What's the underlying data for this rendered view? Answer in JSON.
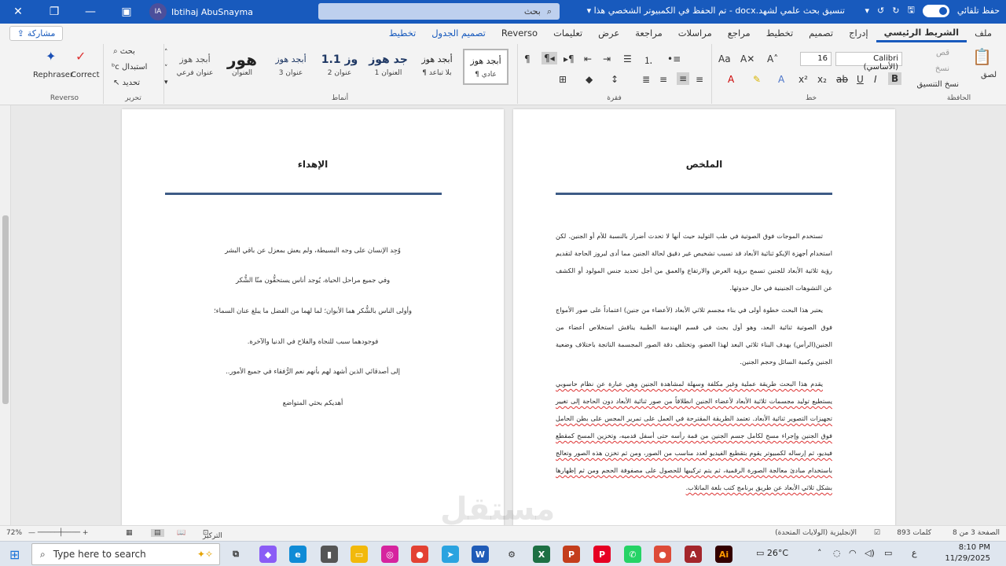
{
  "titlebar": {
    "user_initials": "IA",
    "user_name": "Ibtihaj AbuSnayma",
    "search_placeholder": "بحث",
    "doc_title": "تنسيق بحث علمي لشهد.docx - تم الحفظ في الكمبيوتر الشخصي هذا",
    "autosave_label": "حفظ تلقائي"
  },
  "tabs": [
    "ملف",
    "الشريط الرئيسي",
    "إدراج",
    "تصميم",
    "تخطيط",
    "مراجع",
    "مراسلات",
    "مراجعة",
    "عرض",
    "تعليمات",
    "Reverso",
    "تصميم الجدول",
    "تخطيط"
  ],
  "share_label": "مشاركة",
  "ribbon": {
    "clipboard": {
      "label": "الحافظة",
      "paste": "لصق",
      "cut": "قص",
      "copy": "نسخ",
      "format_painter": "نسخ التنسيق"
    },
    "font": {
      "label": "خط",
      "font_name": "Calibri (الأساسي)",
      "font_size": "16"
    },
    "paragraph": {
      "label": "فقرة"
    },
    "styles": {
      "label": "أنماط",
      "items": [
        {
          "preview": "أبجد هوز",
          "name": "¶ عادي"
        },
        {
          "preview": "أبجد هوز",
          "name": "¶ بلا تباعد"
        },
        {
          "preview": "جد هوز",
          "name": "العنوان 1"
        },
        {
          "preview": "وز 1.1",
          "name": "عنوان 2"
        },
        {
          "preview": "أبجد هوز",
          "name": "عنوان 3"
        },
        {
          "preview": "هور",
          "name": "العنوان"
        },
        {
          "preview": "أبجد هوز",
          "name": "عنوان فرعي"
        }
      ]
    },
    "editing": {
      "label": "تحرير",
      "find": "بحث",
      "replace": "استبدال",
      "select": "تحديد"
    },
    "reverso": {
      "label": "Reverso",
      "rephraser": "Rephraser",
      "correct": "Correct"
    }
  },
  "page_right": {
    "title": "الملخص",
    "paragraphs": [
      "تستخدم الموجات فوق الصوتية في طب التوليد حيث أنها لا تحدث أضرار بالنسبة للأم أو الجنين. لكن استخدام أجهزة الإيكو ثنائية الأبعاد قد تسبب تشخيص غير دقيق لحالة الجنين مما أدى لبروز الحاجة لتقديم رؤية ثلاثية الأبعاد للجنين تسمح برؤية العرض والارتفاع والعمق من أجل تحديد جنس المولود أو الكشف عن التشوهات الجنينية في حال حدوثها.",
      "يعتبر هذا البحث خطوة أولى في بناء مجسم ثلاثي الأبعاد (لأعضاء من جنين) اعتماداً على صور الأمواج فوق الصوتية ثنائية البعد، وهو أول بحث في قسم الهندسة الطبية يناقش استخلاص أعضاء من الجنين(الرأس) بهدف البناء ثلاثي البعد لهذا العضو، وتختلف دقة الصور المجسمة الناتجة باختلاف وضعية الجنين وكمية السائل وحجم الجنين.",
      "يقدم هذا البحث طريقة عملية وغير مكلفة وسهلة لمشاهدة الجنين وهي عبارة عن نظام حاسوبي يستطيع توليد مجسمات ثلاثية الأبعاد لأعضاء الجنين انطلاقاً من صور ثنائية الأبعاد دون الحاجة إلى تغيير تجهيزات التصوير ثنائية الأبعاد. تعتمد الطريقة المقترحة في العمل على تمرير المجس على بطن الحامل فوق الجنين وإجراء مسح لكامل جسم الجنين من قمة رأسه حتى أسفل قدميه، وتخزين المسح كمقطع فيديو، ثم إرساله لكمبيوتر يقوم بتقطيع الفيديو لعدد مناسب من الصور، ومن ثم تخزن هذه الصور وتعالج باستخدام مبادئ معالجة الصورة الرقمية، ثم يتم تركيبها للحصول على مصفوفة الحجم ومن ثم إظهارها بشكل ثلاثي الأبعاد عن طريق برنامج كتب بلغة الماتلاب."
    ]
  },
  "page_left": {
    "title": "الإهداء",
    "lines": [
      "وُجِد الإنسان على وجه البسيطة، ولم يعش بمعزل عن باقي البشر",
      "وفي جميع مراحل الحياة، يُوجد أناس يستحقُّون منّا الشُّكر",
      "وأولى الناس بالشُّكر هما الأبوان؛ لما لهما من الفضل ما يبلغ عنان السماء؛",
      "فوجودهما سبب للنجاة والفلاح في الدنيا والآخرة.",
      "إلى أصدقائي الذين أشهد لهم بأنهم نعم الرُّفقاء في جميع الأمور..",
      "أهديكم بحثي المتواضع"
    ]
  },
  "status": {
    "page": "الصفحة 3 من 8",
    "words": "893 كلمات",
    "language": "الإنجليزية (الولايات المتحدة)",
    "focus": "التركيز",
    "zoom": "72%"
  },
  "taskbar": {
    "search_placeholder": "Type here to search",
    "weather": "26°C",
    "time": "8:10 PM",
    "date": "11/29/2025",
    "lang": "ع"
  },
  "watermark": "مستقل"
}
